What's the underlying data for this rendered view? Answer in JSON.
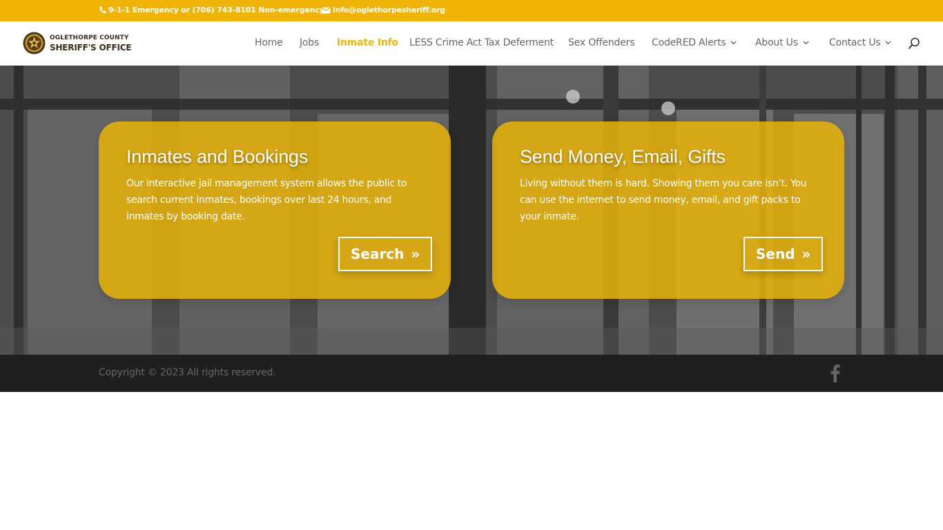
{
  "topbar": {
    "phone_text": "9-1-1 Emergency or (706) 743-8101 Non-emergency",
    "email_text": "info@oglethorpesheriff.org",
    "icons": [
      "phone-icon",
      "envelope-icon"
    ],
    "color": "#efb406"
  },
  "header": {
    "logo_line1": "OGLETHORPE COUNTY",
    "logo_line2": "SHERIFF'S OFFICE",
    "nav": [
      {
        "label": "Home",
        "active": false
      },
      {
        "label": "Jobs",
        "active": false
      },
      {
        "label": "Inmate Info",
        "active": true
      },
      {
        "label": "LESS Crime Act Tax Deferment",
        "active": false
      },
      {
        "label": "Sex Offenders",
        "active": false
      },
      {
        "label": "CodeRED Alerts",
        "active": false,
        "dropdown": true
      },
      {
        "label": "About Us",
        "active": false,
        "dropdown": true
      },
      {
        "label": "Contact Us",
        "active": false,
        "dropdown": true
      }
    ],
    "search_icon": "search-icon"
  },
  "cards": [
    {
      "title": "Inmates and Bookings",
      "body": "Our interactive jail management system allows the public to search current inmates, bookings over last 24 hours, and inmates by booking date.",
      "button_label": "Search",
      "button_arrow": "»"
    },
    {
      "title": "Send Money, Email, Gifts",
      "body": "Living without them is hard. Showing them you care isn’t. You can use the internet to send money, email, and gift packs to your inmate.",
      "button_label": "Send",
      "button_arrow": "»"
    }
  ],
  "footer": {
    "copyright": "Copyright © 2023 All rights reserved.",
    "social_icon": "facebook-icon"
  }
}
